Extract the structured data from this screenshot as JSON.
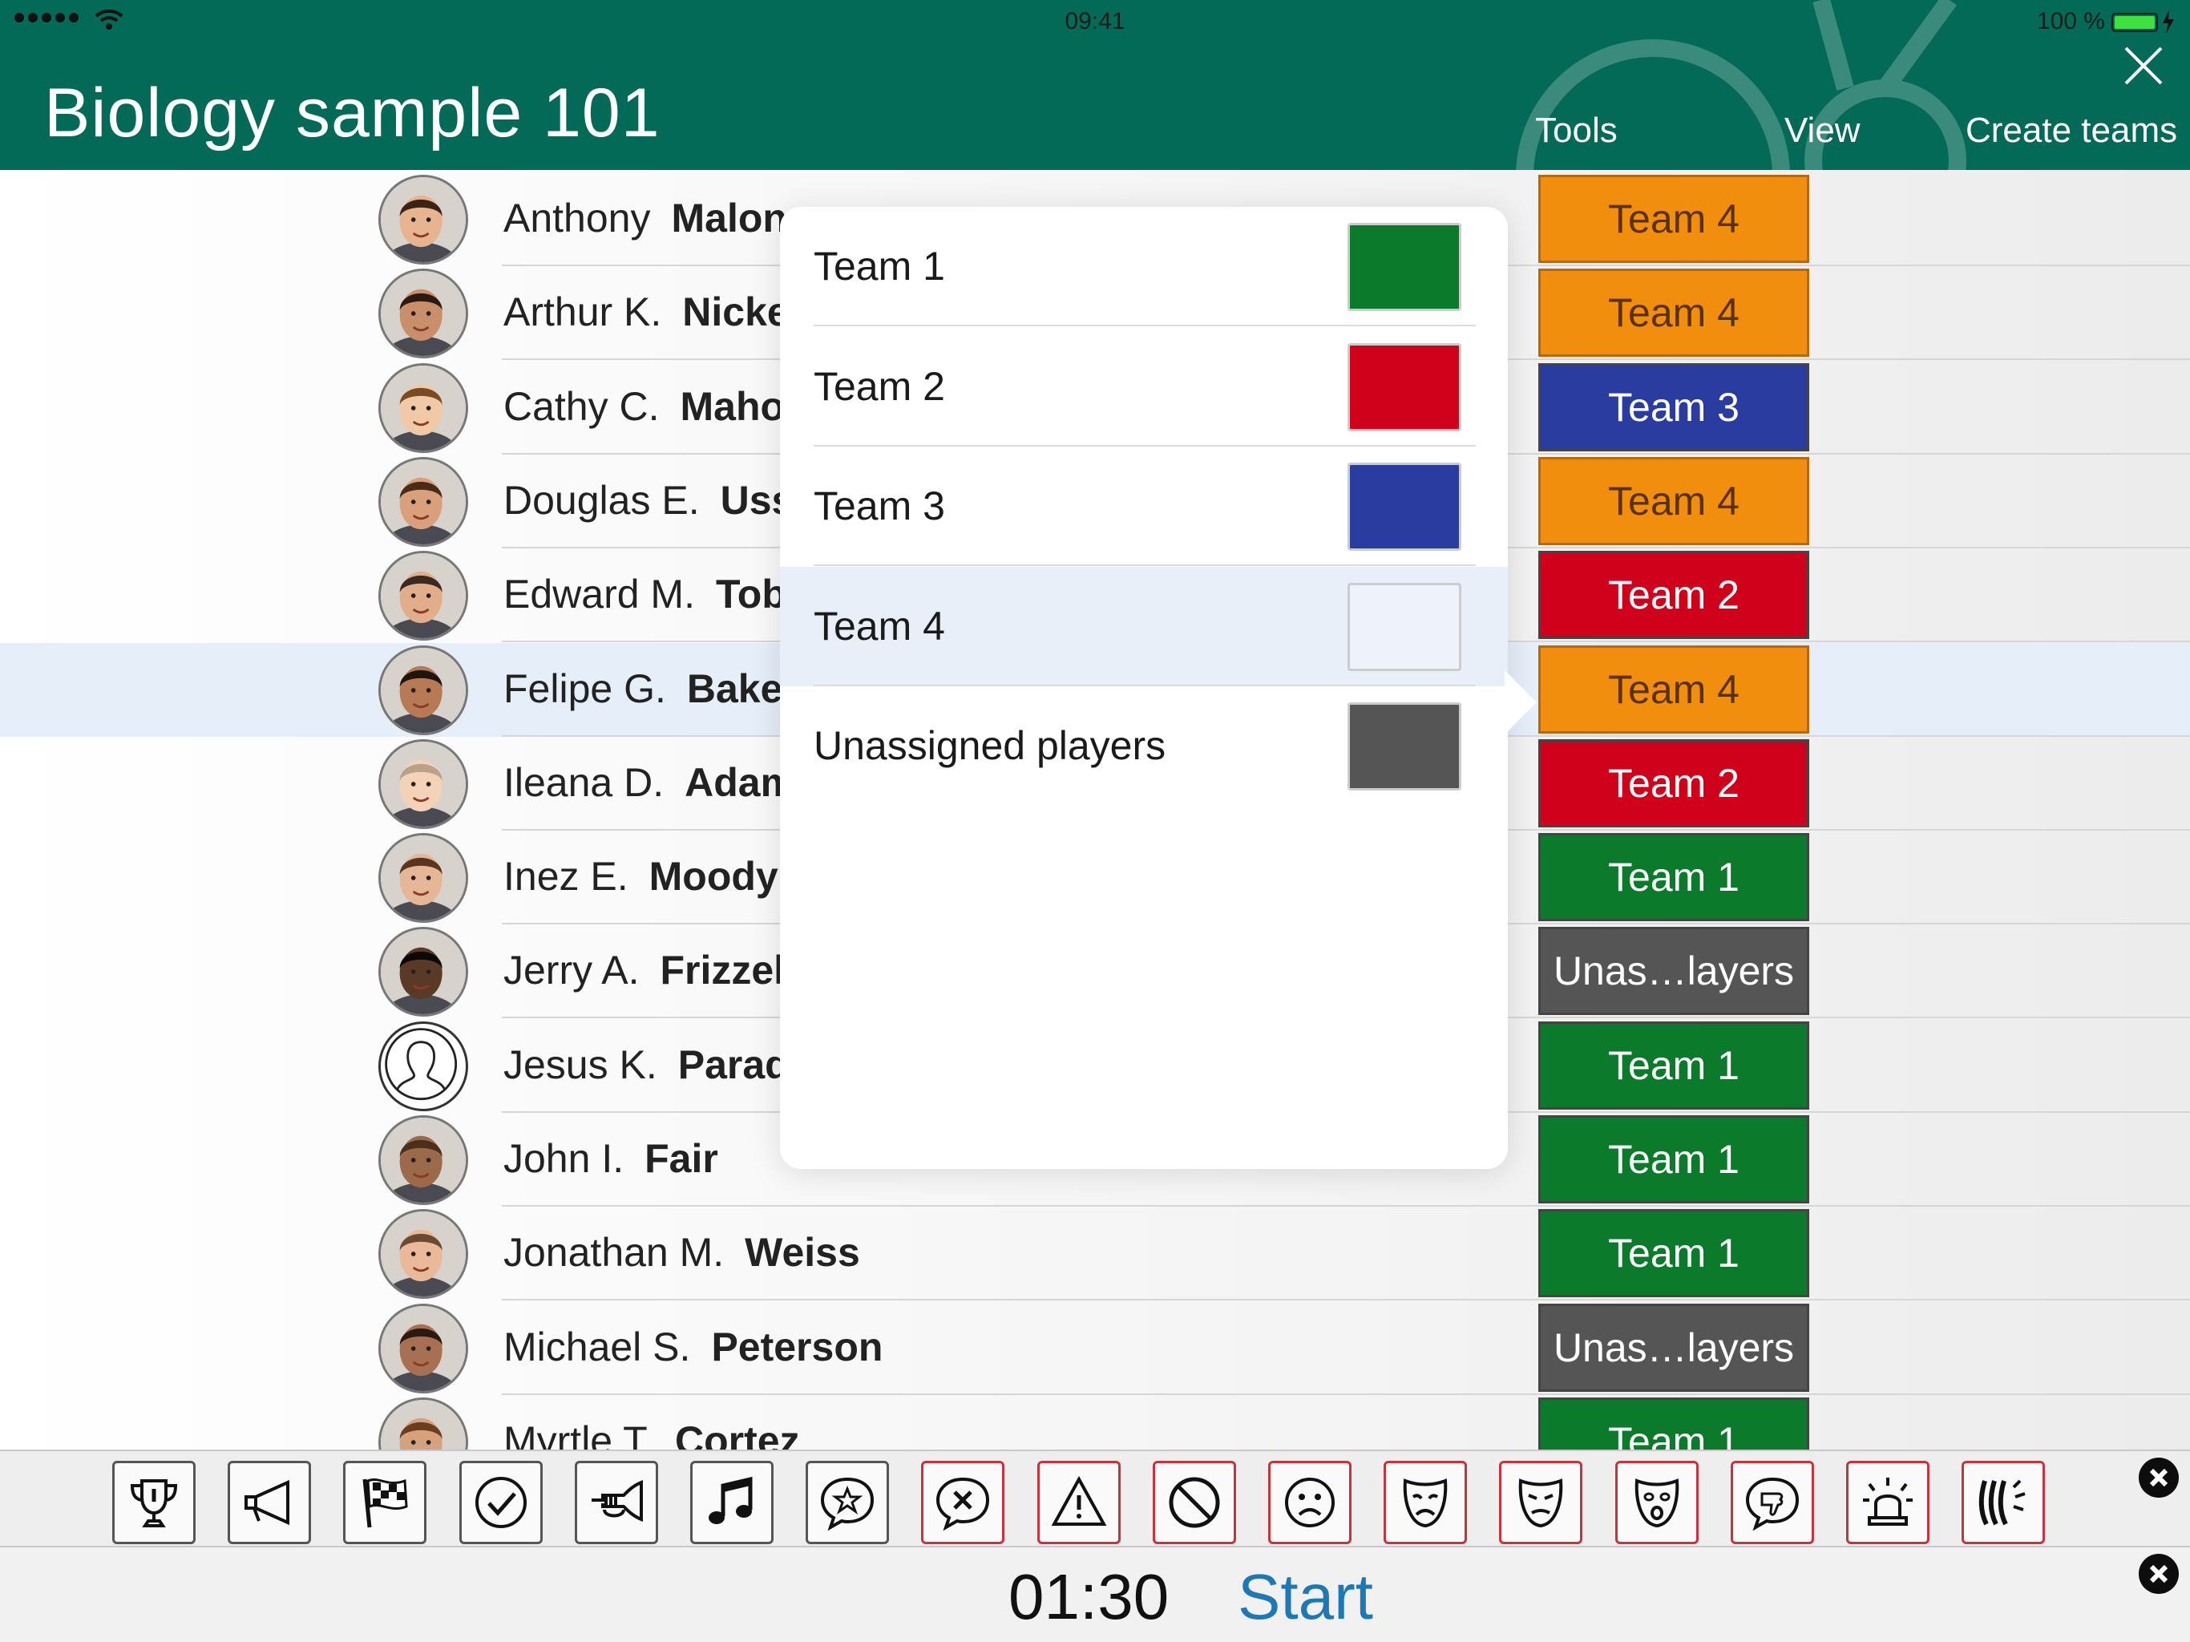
{
  "status": {
    "time": "09:41",
    "battery": "100 %"
  },
  "header": {
    "title": "Biology sample 101",
    "nav": [
      "Tools",
      "View",
      "Create teams"
    ]
  },
  "colors": {
    "team1": "#0b7a2a",
    "team2": "#d0021b",
    "team3": "#2a3c9f",
    "team4": "#f18e0e",
    "unassigned": "#555555",
    "header": "#046a58",
    "start": "#1e78b5"
  },
  "students": [
    {
      "first": "Anthony",
      "last": "Malone",
      "team": "Team 4",
      "color": "#f18e0e",
      "text": "#5a3100"
    },
    {
      "first": "Arthur K.",
      "last": "Nickerson",
      "team": "Team 4",
      "color": "#f18e0e",
      "text": "#5a3100"
    },
    {
      "first": "Cathy  C.",
      "last": "Mahoney",
      "team": "Team 3",
      "color": "#2a3c9f",
      "text": "#ffffff"
    },
    {
      "first": "Douglas E.",
      "last": "Usselman",
      "team": "Team 4",
      "color": "#f18e0e",
      "text": "#5a3100"
    },
    {
      "first": "Edward M.",
      "last": "Tobey",
      "team": "Team 2",
      "color": "#d0021b",
      "text": "#ffffff"
    },
    {
      "first": "Felipe G.",
      "last": "Baker",
      "team": "Team 4",
      "color": "#f18e0e",
      "text": "#5a3100"
    },
    {
      "first": "Ileana D.",
      "last": "Adams",
      "team": "Team 2",
      "color": "#d0021b",
      "text": "#ffffff"
    },
    {
      "first": "Inez E.",
      "last": "Moody",
      "team": "Team 1",
      "color": "#0b7a2a",
      "text": "#ffffff"
    },
    {
      "first": "Jerry A.",
      "last": "Frizzell",
      "team": "Unas…layers",
      "color": "#555555",
      "text": "#ffffff"
    },
    {
      "first": "Jesus K.",
      "last": "Paradis",
      "team": "Team 1",
      "color": "#0b7a2a",
      "text": "#ffffff"
    },
    {
      "first": "John I.",
      "last": "Fair",
      "team": "Team 1",
      "color": "#0b7a2a",
      "text": "#ffffff"
    },
    {
      "first": "Jonathan M.",
      "last": "Weiss",
      "team": "Team 1",
      "color": "#0b7a2a",
      "text": "#ffffff"
    },
    {
      "first": "Michael S.",
      "last": "Peterson",
      "team": "Unas…layers",
      "color": "#555555",
      "text": "#ffffff"
    },
    {
      "first": "Myrtle T.",
      "last": "Cortez",
      "team": "Team 1",
      "color": "#0b7a2a",
      "text": "#ffffff"
    }
  ],
  "popover": {
    "options": [
      {
        "label": "Team 1",
        "color": "#0b7a2a"
      },
      {
        "label": "Team 2",
        "color": "#d0021b"
      },
      {
        "label": "Team 3",
        "color": "#2a3c9f"
      },
      {
        "label": "Team 4",
        "color": "#eef3fb"
      },
      {
        "label": "Unassigned players",
        "color": "#555555"
      }
    ]
  },
  "toolbar": {
    "tools": [
      "trophy-icon",
      "megaphone-icon",
      "checkered-flag-icon",
      "checkmark-icon",
      "trumpet-icon",
      "music-note-icon",
      "star-speech-icon",
      "x-speech-icon",
      "warning-icon",
      "prohibited-icon",
      "sad-face-icon",
      "sad-mask-icon",
      "unhappy-mask-icon",
      "surprised-mask-icon",
      "thumbs-down-icon",
      "alarm-light-icon",
      "applause-icon"
    ]
  },
  "timer": {
    "value": "01:30",
    "start_label": "Start"
  }
}
